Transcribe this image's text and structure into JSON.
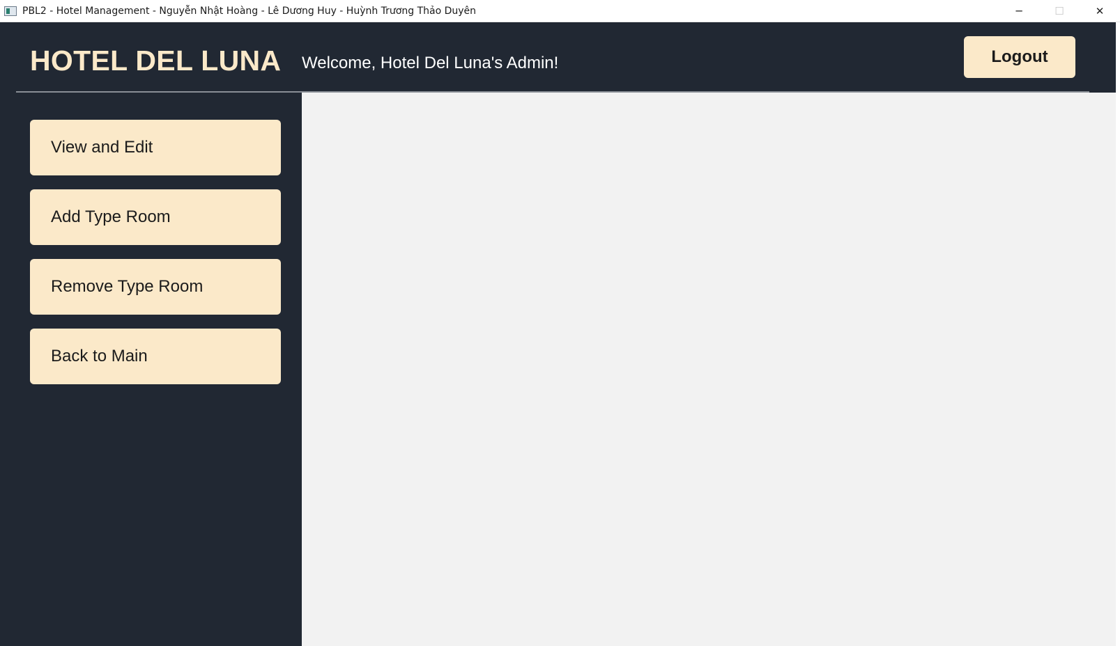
{
  "window": {
    "title": "PBL2 - Hotel Management - Nguyễn Nhật Hoàng - Lê Dương Huy - Huỳnh Trương Thảo Duyên",
    "minimize_glyph": "─",
    "maximize_glyph": "☐",
    "close_glyph": "✕"
  },
  "header": {
    "brand": "HOTEL DEL LUNA",
    "welcome": "Welcome, Hotel Del Luna's Admin!",
    "logout_label": "Logout"
  },
  "sidebar": {
    "items": [
      {
        "label": "View and Edit"
      },
      {
        "label": "Add Type Room"
      },
      {
        "label": "Remove Type Room"
      },
      {
        "label": "Back to Main"
      }
    ]
  },
  "colors": {
    "background_dark": "#212833",
    "button_cream": "#fbe9c9",
    "content_bg": "#f2f2f2"
  }
}
